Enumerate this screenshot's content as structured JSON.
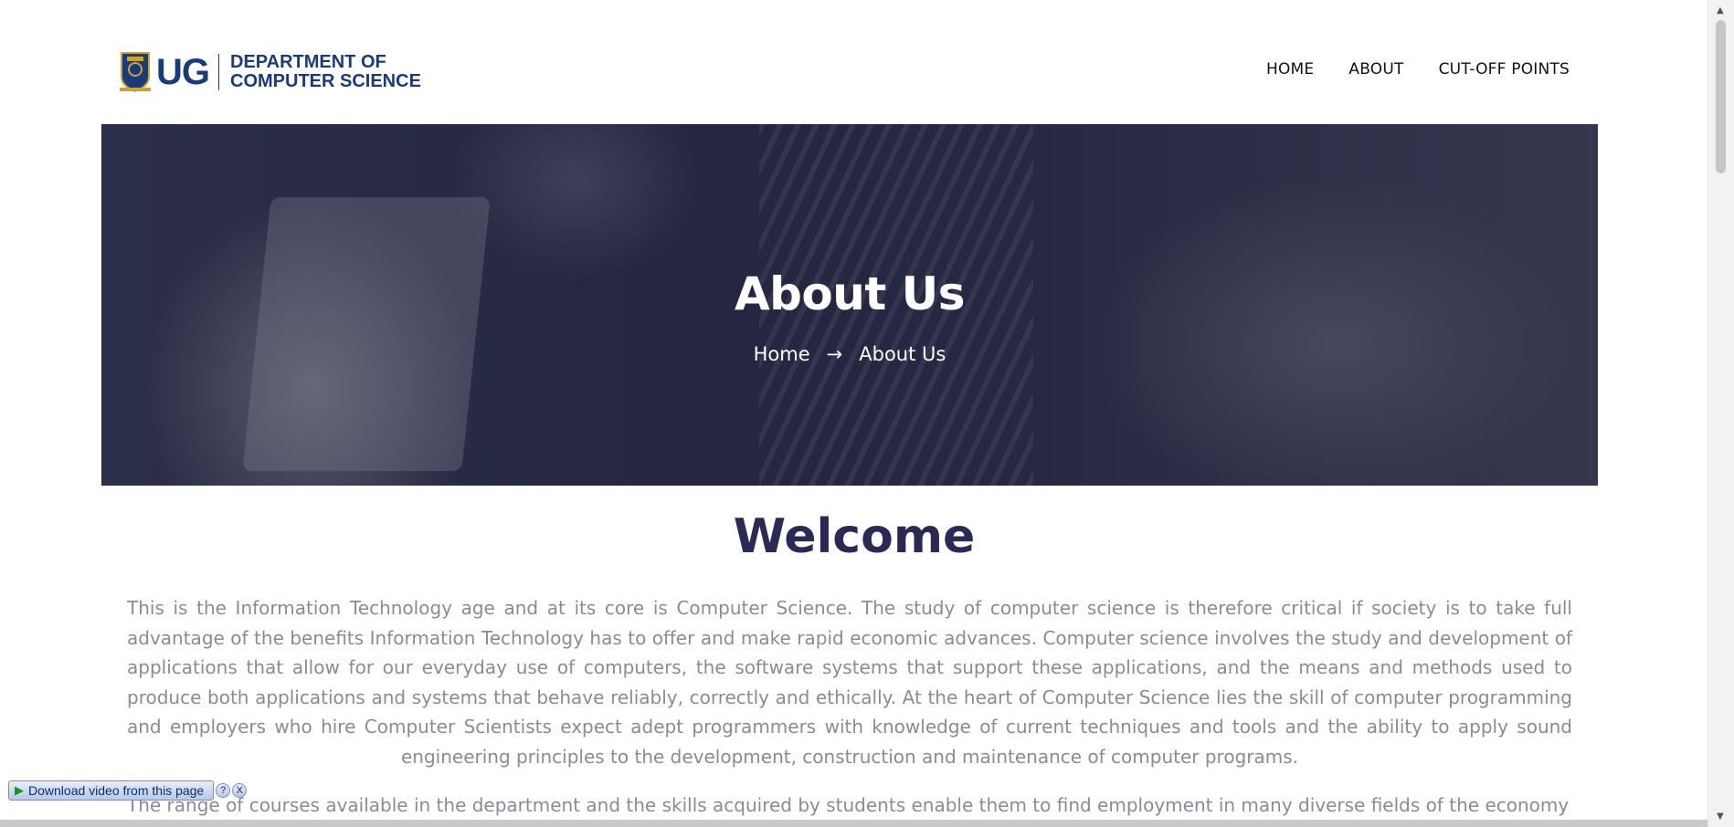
{
  "header": {
    "logo_mark": "UG",
    "logo_line1": "DEPARTMENT OF",
    "logo_line2": "COMPUTER SCIENCE",
    "nav": [
      {
        "label": "HOME"
      },
      {
        "label": "ABOUT"
      },
      {
        "label": "CUT-OFF POINTS"
      }
    ]
  },
  "hero": {
    "title": "About Us",
    "breadcrumb_home": "Home",
    "breadcrumb_arrow": "→",
    "breadcrumb_current": "About Us"
  },
  "content": {
    "heading": "Welcome",
    "paragraph1": "This is the Information Technology age and at its core is Computer Science. The study of computer science is therefore critical if society is to take full advantage of the benefits Information Technology has to offer and make rapid economic advances. Computer science involves the study and development of applications that allow for our everyday use of computers, the software systems that support these applications, and the means and methods used to produce both applications and systems that behave reliably, correctly and ethically. At the heart of Computer Science lies the skill of computer programming and employers who hire Computer Scientists expect adept programmers with knowledge of current techniques and tools and the ability to apply sound engineering principles to the development, construction and maintenance of computer programs.",
    "paragraph2": "The range of courses available in the department and the skills acquired by students enable them to find employment in many diverse fields of the economy"
  },
  "download_widget": {
    "label": "Download video from this page",
    "help": "?",
    "close": "X"
  },
  "colors": {
    "brand": "#1b3a78",
    "heading": "#2b2a55",
    "body_text": "#8a8a98",
    "hero_overlay": "#1c1e3c"
  }
}
